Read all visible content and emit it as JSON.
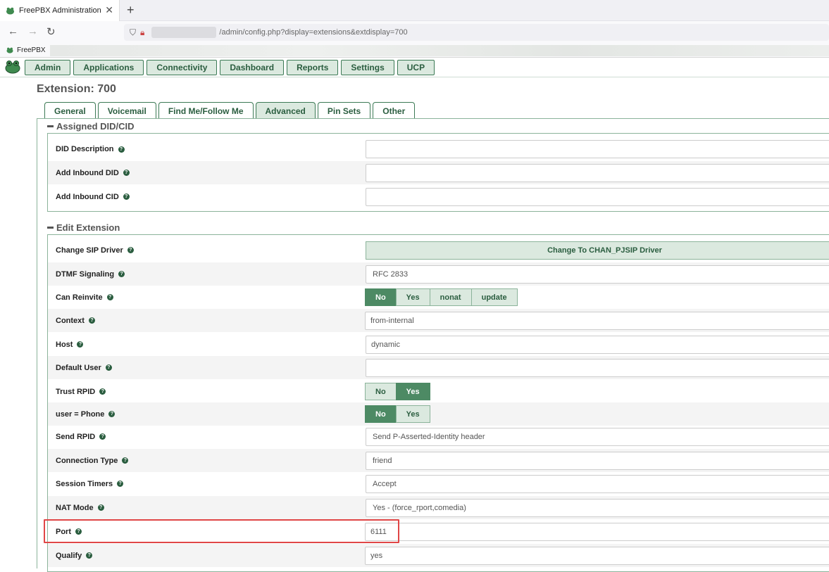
{
  "browser": {
    "tab_title": "FreePBX Administration",
    "tab_close": "✕",
    "new_tab": "+",
    "url": "/admin/config.php?display=extensions&extdisplay=700",
    "bookmark": "FreePBX"
  },
  "menu": [
    "Admin",
    "Applications",
    "Connectivity",
    "Dashboard",
    "Reports",
    "Settings",
    "UCP"
  ],
  "page_title": "Extension: 700",
  "tabs": [
    "General",
    "Voicemail",
    "Find Me/Follow Me",
    "Advanced",
    "Pin Sets",
    "Other"
  ],
  "active_tab": "Advanced",
  "sections": {
    "assigned": {
      "title": "Assigned DID/CID",
      "rows": [
        {
          "label": "DID Description",
          "value": ""
        },
        {
          "label": "Add Inbound DID",
          "value": ""
        },
        {
          "label": "Add Inbound CID",
          "value": ""
        }
      ]
    },
    "edit": {
      "title": "Edit Extension",
      "change_sip_driver": {
        "label": "Change SIP Driver",
        "button": "Change To CHAN_PJSIP Driver"
      },
      "dtmf": {
        "label": "DTMF Signaling",
        "value": "RFC 2833"
      },
      "can_reinvite": {
        "label": "Can Reinvite",
        "options": [
          "No",
          "Yes",
          "nonat",
          "update"
        ],
        "selected": "No"
      },
      "context": {
        "label": "Context",
        "value": "from-internal"
      },
      "host": {
        "label": "Host",
        "value": "dynamic"
      },
      "default_user": {
        "label": "Default User",
        "value": ""
      },
      "trust_rpid": {
        "label": "Trust RPID",
        "options": [
          "No",
          "Yes"
        ],
        "selected": "Yes"
      },
      "user_phone": {
        "label": "user = Phone",
        "options": [
          "No",
          "Yes"
        ],
        "selected": "No"
      },
      "send_rpid": {
        "label": "Send RPID",
        "value": "Send P-Asserted-Identity header"
      },
      "connection_type": {
        "label": "Connection Type",
        "value": "friend"
      },
      "session_timers": {
        "label": "Session Timers",
        "value": "Accept"
      },
      "nat_mode": {
        "label": "NAT Mode",
        "value": "Yes - (force_rport,comedia)"
      },
      "port": {
        "label": "Port",
        "value": "6111"
      },
      "qualify": {
        "label": "Qualify",
        "value": "yes"
      }
    }
  },
  "help_glyph": "?",
  "colors": {
    "accent": "#2a5d3f",
    "button_bg": "#dbe9df",
    "selected": "#4d8a64",
    "highlight": "#e04646"
  }
}
